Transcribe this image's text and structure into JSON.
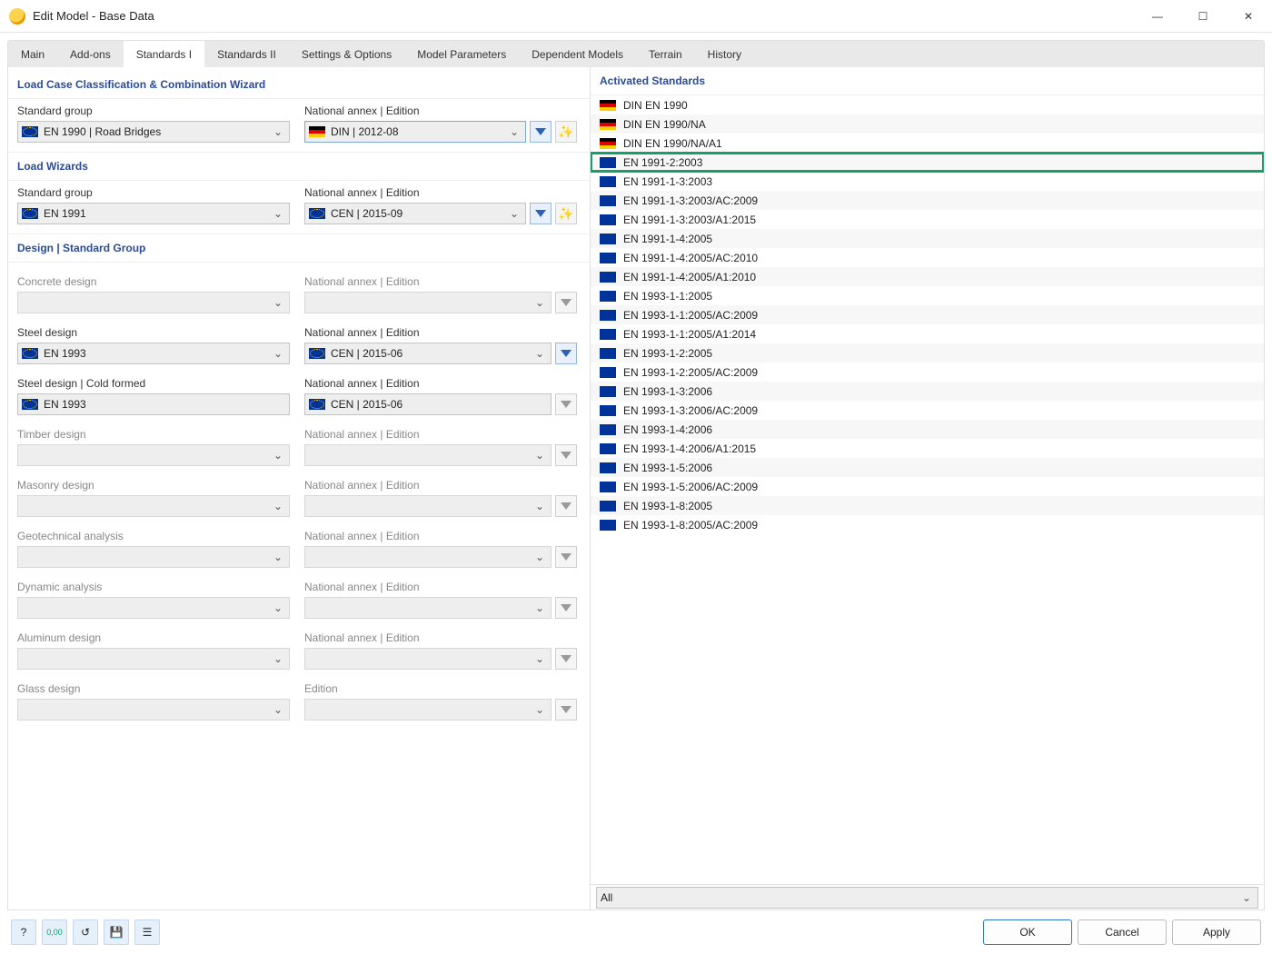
{
  "window": {
    "title": "Edit Model - Base Data"
  },
  "tabs": [
    "Main",
    "Add-ons",
    "Standards I",
    "Standards II",
    "Settings & Options",
    "Model Parameters",
    "Dependent Models",
    "Terrain",
    "History"
  ],
  "activeTab": "Standards I",
  "sections": {
    "loadcase": {
      "title": "Load Case Classification & Combination Wizard",
      "std_label": "Standard group",
      "std_value": "EN 1990 | Road Bridges",
      "std_flag": "eu",
      "annex_label": "National annex | Edition",
      "annex_value": "DIN | 2012-08",
      "annex_flag": "de"
    },
    "loadwizards": {
      "title": "Load Wizards",
      "std_label": "Standard group",
      "std_value": "EN 1991",
      "std_flag": "eu",
      "annex_label": "National annex | Edition",
      "annex_value": "CEN | 2015-09",
      "annex_flag": "eu"
    },
    "design": {
      "title": "Design | Standard Group",
      "rows": [
        {
          "label": "Concrete design",
          "value": "",
          "flag": "",
          "enabled": false,
          "annex_label": "National annex | Edition",
          "annex_value": "",
          "annex_enabled": false
        },
        {
          "label": "Steel design",
          "value": "EN 1993",
          "flag": "eu",
          "enabled": true,
          "annex_label": "National annex | Edition",
          "annex_value": "CEN | 2015-06",
          "annex_enabled": true,
          "filter_active": true
        },
        {
          "label": "Steel design | Cold formed",
          "value": "EN 1993",
          "flag": "eu",
          "enabled": true,
          "annex_label": "National annex | Edition",
          "annex_value": "CEN | 2015-06",
          "annex_enabled": true,
          "no_chev": true
        },
        {
          "label": "Timber design",
          "value": "",
          "flag": "",
          "enabled": false,
          "annex_label": "National annex | Edition",
          "annex_value": "",
          "annex_enabled": false
        },
        {
          "label": "Masonry design",
          "value": "",
          "flag": "",
          "enabled": false,
          "annex_label": "National annex | Edition",
          "annex_value": "",
          "annex_enabled": false
        },
        {
          "label": "Geotechnical analysis",
          "value": "",
          "flag": "",
          "enabled": false,
          "annex_label": "National annex | Edition",
          "annex_value": "",
          "annex_enabled": false
        },
        {
          "label": "Dynamic analysis",
          "value": "",
          "flag": "",
          "enabled": false,
          "annex_label": "National annex | Edition",
          "annex_value": "",
          "annex_enabled": false
        },
        {
          "label": "Aluminum design",
          "value": "",
          "flag": "",
          "enabled": false,
          "annex_label": "National annex | Edition",
          "annex_value": "",
          "annex_enabled": false
        },
        {
          "label": "Glass design",
          "value": "",
          "flag": "",
          "enabled": false,
          "annex_label": "Edition",
          "annex_value": "",
          "annex_enabled": false
        }
      ]
    }
  },
  "activated": {
    "title": "Activated Standards",
    "items": [
      {
        "flag": "de",
        "name": "DIN EN 1990"
      },
      {
        "flag": "de",
        "name": "DIN EN 1990/NA"
      },
      {
        "flag": "de",
        "name": "DIN EN 1990/NA/A1"
      },
      {
        "flag": "eu",
        "name": "EN 1991-2:2003",
        "highlight": true
      },
      {
        "flag": "eu",
        "name": "EN 1991-1-3:2003"
      },
      {
        "flag": "eu",
        "name": "EN 1991-1-3:2003/AC:2009"
      },
      {
        "flag": "eu",
        "name": "EN 1991-1-3:2003/A1:2015"
      },
      {
        "flag": "eu",
        "name": "EN 1991-1-4:2005"
      },
      {
        "flag": "eu",
        "name": "EN 1991-1-4:2005/AC:2010"
      },
      {
        "flag": "eu",
        "name": "EN 1991-1-4:2005/A1:2010"
      },
      {
        "flag": "eu",
        "name": "EN 1993-1-1:2005"
      },
      {
        "flag": "eu",
        "name": "EN 1993-1-1:2005/AC:2009"
      },
      {
        "flag": "eu",
        "name": "EN 1993-1-1:2005/A1:2014"
      },
      {
        "flag": "eu",
        "name": "EN 1993-1-2:2005"
      },
      {
        "flag": "eu",
        "name": "EN 1993-1-2:2005/AC:2009"
      },
      {
        "flag": "eu",
        "name": "EN 1993-1-3:2006"
      },
      {
        "flag": "eu",
        "name": "EN 1993-1-3:2006/AC:2009"
      },
      {
        "flag": "eu",
        "name": "EN 1993-1-4:2006"
      },
      {
        "flag": "eu",
        "name": "EN 1993-1-4:2006/A1:2015"
      },
      {
        "flag": "eu",
        "name": "EN 1993-1-5:2006"
      },
      {
        "flag": "eu",
        "name": "EN 1993-1-5:2006/AC:2009"
      },
      {
        "flag": "eu",
        "name": "EN 1993-1-8:2005"
      },
      {
        "flag": "eu",
        "name": "EN 1993-1-8:2005/AC:2009"
      }
    ],
    "filter_value": "All"
  },
  "buttons": {
    "ok": "OK",
    "cancel": "Cancel",
    "apply": "Apply"
  }
}
